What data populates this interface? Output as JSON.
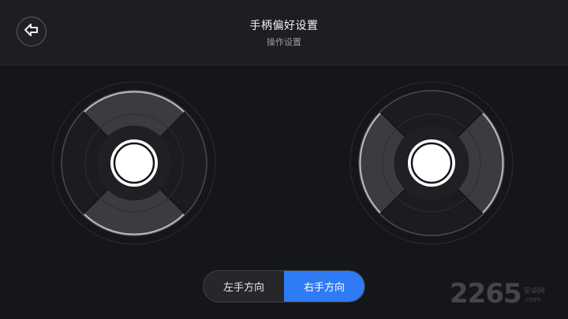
{
  "header": {
    "title": "手柄偏好设置",
    "subtitle": "操作设置",
    "back_icon": "arrow-left-icon"
  },
  "sticks": [
    {
      "side": "left",
      "highlighted_sectors": [
        "up",
        "down"
      ]
    },
    {
      "side": "right",
      "highlighted_sectors": [
        "left",
        "right"
      ]
    }
  ],
  "direction_toggle": {
    "options": [
      "左手方向",
      "右手方向"
    ],
    "selected": "右手方向"
  },
  "watermark": {
    "number": "2265",
    "text_top": "安卓网",
    "text_bottom": ".com"
  },
  "colors": {
    "background": "#151619",
    "header": "#1d1e21",
    "accent": "#2f7bf5",
    "sector_highlight": "#3b3c40"
  }
}
